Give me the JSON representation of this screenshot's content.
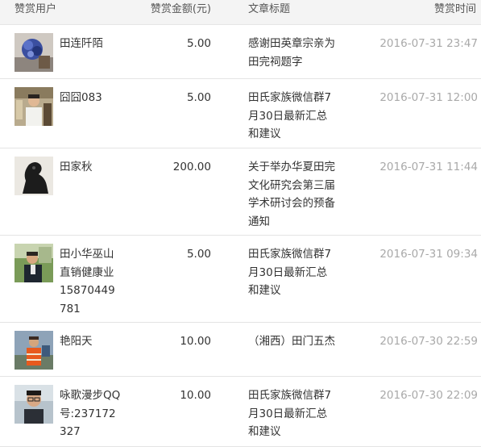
{
  "header": {
    "user": "赞赏用户",
    "amount": "赞赏金额(元)",
    "title": "文章标题",
    "time": "赞赏时间"
  },
  "rows": [
    {
      "user": "田连阡陌",
      "amount": "5.00",
      "title": "感谢田英章宗亲为田完祠题字",
      "time": "2016-07-31 23:47",
      "avatar": "flower-photo"
    },
    {
      "user": "囧囧083",
      "amount": "5.00",
      "title": "田氏家族微信群7月30日最新汇总和建议",
      "time": "2016-07-31 12:00",
      "avatar": "man-photo"
    },
    {
      "user": "田家秋",
      "amount": "200.00",
      "title": "关于举办华夏田完文化研究会第三届学术研讨会的预备通知",
      "time": "2016-07-31 11:44",
      "avatar": "horse-statue-photo"
    },
    {
      "user": "田小华巫山直销健康业15870449781",
      "amount": "5.00",
      "title": "田氏家族微信群7月30日最新汇总和建议",
      "time": "2016-07-31 09:34",
      "avatar": "man-outdoor-photo"
    },
    {
      "user": "艳阳天",
      "amount": "10.00",
      "title": "（湘西）田门五杰",
      "time": "2016-07-30 22:59",
      "avatar": "worker-photo"
    },
    {
      "user": "咏歌漫步QQ号:237172327",
      "amount": "10.00",
      "title": "田氏家族微信群7月30日最新汇总和建议",
      "time": "2016-07-30 22:09",
      "avatar": "glasses-man-photo"
    }
  ]
}
